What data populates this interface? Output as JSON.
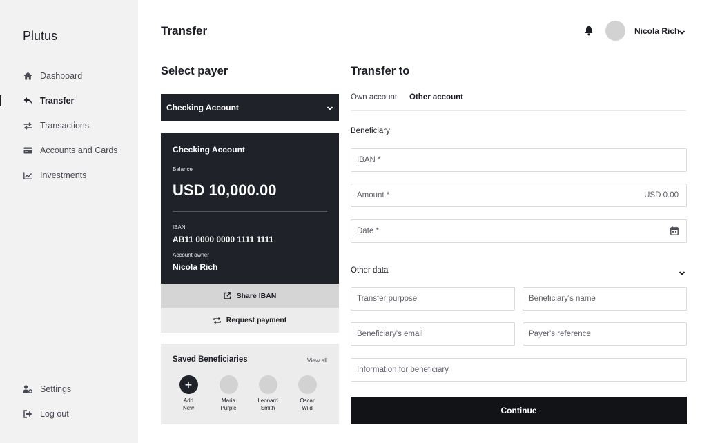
{
  "sidebar": {
    "brand": "Plutus",
    "items": [
      {
        "label": "Dashboard",
        "icon": "home-icon"
      },
      {
        "label": "Transfer",
        "icon": "reply-arrow-icon",
        "active": true
      },
      {
        "label": "Transactions",
        "icon": "exchange-arrows-icon"
      },
      {
        "label": "Accounts and Cards",
        "icon": "credit-card-icon"
      },
      {
        "label": "Investments",
        "icon": "line-chart-icon"
      }
    ],
    "bottom_items": [
      {
        "label": "Settings",
        "icon": "user-cog-icon"
      },
      {
        "label": "Log out",
        "icon": "sign-out-icon"
      }
    ]
  },
  "header": {
    "title": "Transfer",
    "user_name": "Nicola Rich"
  },
  "payer": {
    "title": "Select payer",
    "selected_account": "Checking Account",
    "card": {
      "name": "Checking Account",
      "balance_label": "Balance",
      "balance": "USD 10,000.00",
      "iban_label": "IBAN",
      "iban": "AB11 0000 0000 1111 1111",
      "owner_label": "Account owner",
      "owner": "Nicola Rich"
    },
    "share_label": "Share IBAN",
    "request_label": "Request payment"
  },
  "saved": {
    "title": "Saved Beneficiaries",
    "view_all": "View all",
    "add": {
      "line1": "Add",
      "line2": "New"
    },
    "people": [
      {
        "line1": "Maria",
        "line2": "Purple"
      },
      {
        "line1": "Leonard",
        "line2": "Smith"
      },
      {
        "line1": "Oscar",
        "line2": "Wild"
      }
    ]
  },
  "transfer": {
    "title": "Transfer to",
    "tabs": [
      {
        "label": "Own account",
        "active": false
      },
      {
        "label": "Other account",
        "active": true
      }
    ],
    "beneficiary_label": "Beneficiary",
    "iban_placeholder": "IBAN *",
    "amount_placeholder": "Amount *",
    "amount_suffix": "USD 0.00",
    "date_placeholder": "Date *",
    "other_data_label": "Other data",
    "purpose_placeholder": "Transfer purpose",
    "benef_name_placeholder": "Beneficiary's name",
    "benef_email_placeholder": "Beneficiary's email",
    "payer_ref_placeholder": "Payer's reference",
    "info_placeholder": "Information for beneficiary",
    "continue_label": "Continue"
  },
  "colors": {
    "sidebar_bg": "#f2f2f2",
    "dark": "#20222a",
    "button_bg": "#121317"
  }
}
